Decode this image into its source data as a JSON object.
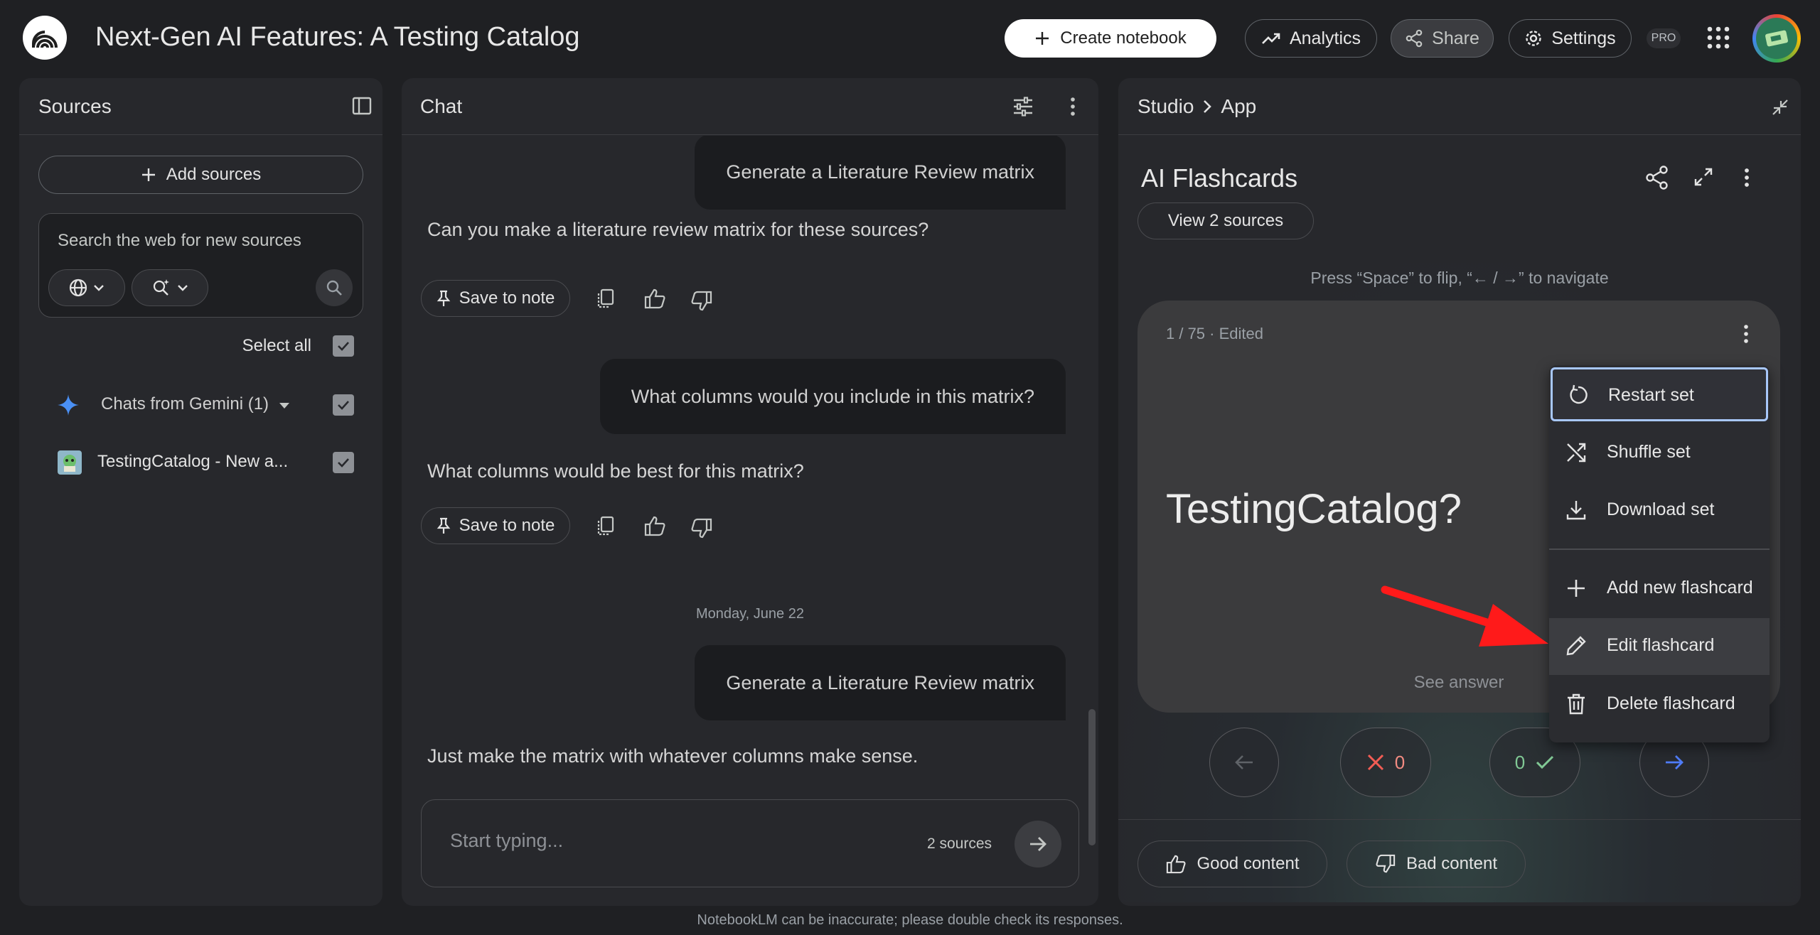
{
  "app": {
    "title": "Next-Gen AI Features: A Testing Catalog",
    "create_notebook": "Create notebook",
    "analytics": "Analytics",
    "share": "Share",
    "settings": "Settings",
    "pro_badge": "PRO"
  },
  "sources": {
    "title": "Sources",
    "add_sources": "Add sources",
    "search_placeholder": "Search the web for new sources",
    "select_all": "Select all",
    "items": [
      {
        "label": "Chats from Gemini (1)",
        "checked": true
      },
      {
        "label": "TestingCatalog - New a...",
        "checked": true
      }
    ]
  },
  "chat": {
    "title": "Chat",
    "messages": [
      {
        "role": "user",
        "text": "Generate a Literature Review matrix"
      },
      {
        "role": "assistant",
        "text": "Can you make a literature review matrix for these sources?",
        "save_label": "Save to note"
      },
      {
        "role": "user",
        "text": "What columns would you include in this matrix?"
      },
      {
        "role": "assistant",
        "text": "What columns would be best for this matrix?",
        "save_label": "Save to note"
      },
      {
        "role": "user",
        "text": "Generate a Literature Review matrix"
      },
      {
        "role": "assistant",
        "text": "Just make the matrix with whatever columns make sense."
      }
    ],
    "date_separator": "Monday, June 22",
    "composer_placeholder": "Start typing...",
    "source_count": "2 sources"
  },
  "studio": {
    "breadcrumb_root": "Studio",
    "breadcrumb_current": "App",
    "flashcards_title": "AI Flashcards",
    "view_sources": "View 2 sources",
    "hint": "Press “Space” to flip, “← / →” to navigate",
    "card_meta": "1 / 75 · Edited",
    "card_question": "TestingCatalog?",
    "see_answer": "See answer",
    "wrong_count": "0",
    "right_count": "0",
    "good_content": "Good content",
    "bad_content": "Bad content"
  },
  "menu": {
    "items": [
      {
        "label": "Restart set",
        "icon": "restart-icon"
      },
      {
        "label": "Shuffle set",
        "icon": "shuffle-icon"
      },
      {
        "label": "Download set",
        "icon": "download-icon"
      },
      {
        "label": "Add new flashcard",
        "icon": "plus-icon"
      },
      {
        "label": "Edit flashcard",
        "icon": "pencil-icon"
      },
      {
        "label": "Delete flashcard",
        "icon": "trash-icon"
      }
    ]
  },
  "footer": "NotebookLM can be inaccurate; please double check its responses.",
  "colors": {
    "background": "#1f2023",
    "panel": "#27282c",
    "accent_blue": "#8ab4f8",
    "wrong_red": "#f28b82",
    "right_green": "#81c995",
    "annotation_arrow": "#ff0000"
  }
}
